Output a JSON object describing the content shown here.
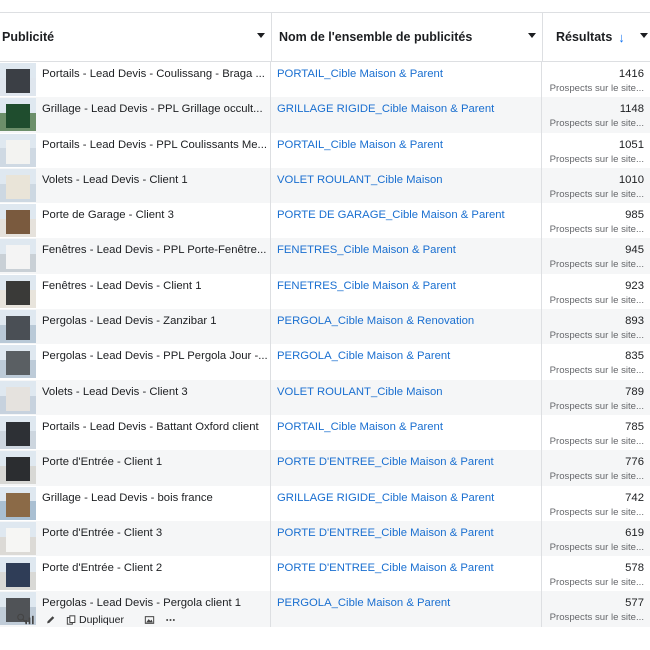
{
  "header": {
    "col_ad": "Publicité",
    "col_adset": "Nom de l'ensemble de publicités",
    "col_results": "Résultats",
    "sort_arrow": "↓"
  },
  "rows": [
    {
      "ad": "Portails - Lead Devis - Coulissang - Braga ...",
      "adset": "PORTAIL_Cible Maison & Parent",
      "value": "1416",
      "sub": "Prospects sur le site...",
      "thumb": "gate-dark"
    },
    {
      "ad": "Grillage - Lead Devis - PPL Grillage occult...",
      "adset": "GRILLAGE RIGIDE_Cible Maison & Parent",
      "value": "1148",
      "sub": "Prospects sur le site...",
      "thumb": "fence-green"
    },
    {
      "ad": "Portails - Lead Devis - PPL Coulissants Me...",
      "adset": "PORTAIL_Cible Maison & Parent",
      "value": "1051",
      "sub": "Prospects sur le site...",
      "thumb": "gate-white"
    },
    {
      "ad": "Volets - Lead Devis - Client 1",
      "adset": "VOLET ROULANT_Cible Maison",
      "value": "1010",
      "sub": "Prospects sur le site...",
      "thumb": "house"
    },
    {
      "ad": "Porte de Garage - Client 3",
      "adset": "PORTE DE GARAGE_Cible Maison & Parent",
      "value": "985",
      "sub": "Prospects sur le site...",
      "thumb": "garage"
    },
    {
      "ad": "Fenêtres - Lead Devis - PPL Porte-Fenêtre...",
      "adset": "FENETRES_Cible Maison & Parent",
      "value": "945",
      "sub": "Prospects sur le site...",
      "thumb": "window-door"
    },
    {
      "ad": "Fenêtres - Lead Devis - Client 1",
      "adset": "FENETRES_Cible Maison & Parent",
      "value": "923",
      "sub": "Prospects sur le site...",
      "thumb": "window"
    },
    {
      "ad": "Pergolas - Lead Devis - Zanzibar 1",
      "adset": "PERGOLA_Cible Maison & Renovation",
      "value": "893",
      "sub": "Prospects sur le site...",
      "thumb": "pergola"
    },
    {
      "ad": "Pergolas - Lead Devis - PPL Pergola Jour -...",
      "adset": "PERGOLA_Cible Maison & Parent",
      "value": "835",
      "sub": "Prospects sur le site...",
      "thumb": "pergola-2"
    },
    {
      "ad": "Volets - Lead Devis - Client 3",
      "adset": "VOLET ROULANT_Cible Maison",
      "value": "789",
      "sub": "Prospects sur le site...",
      "thumb": "house-2"
    },
    {
      "ad": "Portails - Lead Devis - Battant Oxford client",
      "adset": "PORTAIL_Cible Maison & Parent",
      "value": "785",
      "sub": "Prospects sur le site...",
      "thumb": "gate-swing"
    },
    {
      "ad": "Porte d'Entrée - Client 1",
      "adset": "PORTE D'ENTREE_Cible Maison & Parent",
      "value": "776",
      "sub": "Prospects sur le site...",
      "thumb": "front-door"
    },
    {
      "ad": "Grillage - Lead Devis - bois france",
      "adset": "GRILLAGE RIGIDE_Cible Maison & Parent",
      "value": "742",
      "sub": "Prospects sur le site...",
      "thumb": "wood-fence"
    },
    {
      "ad": "Porte d'Entrée - Client 3",
      "adset": "PORTE D'ENTREE_Cible Maison & Parent",
      "value": "619",
      "sub": "Prospects sur le site...",
      "thumb": "front-door-2"
    },
    {
      "ad": "Porte d'Entrée - Client 2",
      "adset": "PORTE D'ENTREE_Cible Maison & Parent",
      "value": "578",
      "sub": "Prospects sur le site...",
      "thumb": "front-door-3"
    },
    {
      "ad": "Pergolas - Lead Devis - Pergola client 1",
      "adset": "PERGOLA_Cible Maison & Parent",
      "value": "577",
      "sub": "Prospects sur le site...",
      "thumb": "pergola-3"
    }
  ],
  "actions": {
    "duplicate_label": "Dupliquer"
  },
  "colors": {
    "link": "#1a6fd0",
    "sort_arrow": "#1877f2",
    "row_alt": "#f5f6f7",
    "border": "#dddfe2"
  }
}
